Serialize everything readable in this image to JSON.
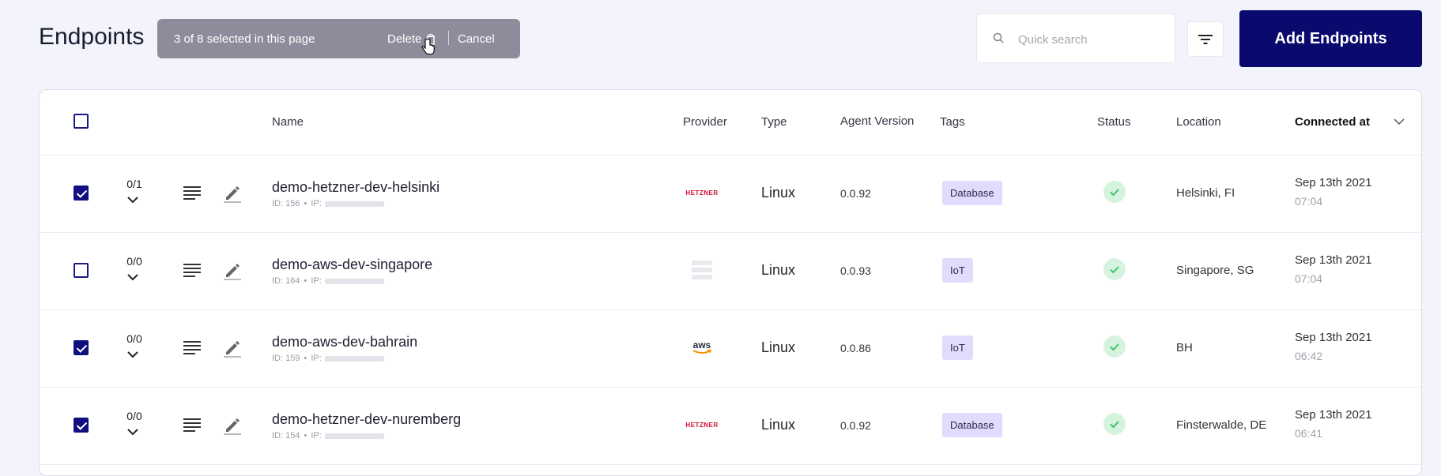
{
  "page": {
    "title": "Endpoints"
  },
  "selection_bar": {
    "text": "3 of 8 selected in this page",
    "delete_label": "Delete",
    "cancel_label": "Cancel"
  },
  "search": {
    "placeholder": "Quick search",
    "value": ""
  },
  "add_button": {
    "label": "Add Endpoints"
  },
  "table": {
    "headers": {
      "name": "Name",
      "provider": "Provider",
      "type": "Type",
      "agent_version": "Agent Version",
      "tags": "Tags",
      "status": "Status",
      "location": "Location",
      "connected_at": "Connected at"
    },
    "rows": [
      {
        "checked": true,
        "count": "0/1",
        "name": "demo-hetzner-dev-helsinki",
        "id": "ID: 156",
        "ip": "IP:",
        "provider": "HETZNER",
        "type": "Linux",
        "version": "0.0.92",
        "tag": "Database",
        "location": "Helsinki, FI",
        "date": "Sep 13th 2021",
        "time": "07:04"
      },
      {
        "checked": false,
        "count": "0/0",
        "name": "demo-aws-dev-singapore",
        "id": "ID: 164",
        "ip": "IP:",
        "provider": "",
        "type": "Linux",
        "version": "0.0.93",
        "tag": "IoT",
        "location": "Singapore, SG",
        "date": "Sep 13th 2021",
        "time": "07:04"
      },
      {
        "checked": true,
        "count": "0/0",
        "name": "demo-aws-dev-bahrain",
        "id": "ID: 159",
        "ip": "IP:",
        "provider": "aws",
        "type": "Linux",
        "version": "0.0.86",
        "tag": "IoT",
        "location": "BH",
        "date": "Sep 13th 2021",
        "time": "06:42"
      },
      {
        "checked": true,
        "count": "0/0",
        "name": "demo-hetzner-dev-nuremberg",
        "id": "ID: 154",
        "ip": "IP:",
        "provider": "HETZNER",
        "type": "Linux",
        "version": "0.0.92",
        "tag": "Database",
        "location": "Finsterwalde, DE",
        "date": "Sep 13th 2021",
        "time": "06:41"
      }
    ]
  },
  "icons": {
    "search": "search-icon",
    "filter": "filter-icon",
    "trash": "trash-icon",
    "cursor": "hand-cursor-icon",
    "expand": "chevron-down-icon",
    "details": "lines-icon",
    "edit": "pencil-icon",
    "status": "check-circle-icon",
    "sort": "chevron-down-icon"
  },
  "colors": {
    "accent": "#0a0a6e",
    "tag_bg": "#e1dcfb",
    "status_ok": "#3fc46b",
    "selection_bar": "#8c8c9a",
    "hetzner": "#d50c2d",
    "aws_orange": "#f29100"
  }
}
